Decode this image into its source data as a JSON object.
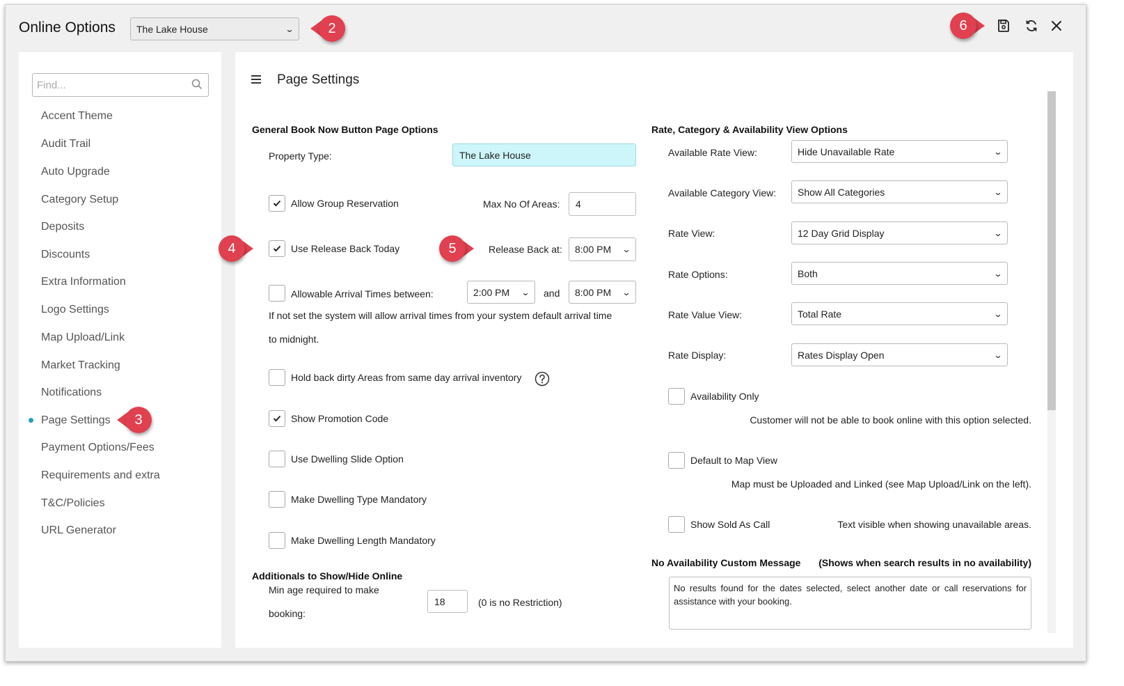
{
  "header": {
    "title": "Online Options",
    "property_select": "The Lake House",
    "callouts": {
      "c2": "2",
      "c3": "3",
      "c4": "4",
      "c5": "5",
      "c6": "6"
    }
  },
  "toolbar_icons": [
    "save-icon",
    "refresh-icon",
    "close-icon"
  ],
  "sidebar": {
    "search_placeholder": "Find...",
    "items": [
      "Accent Theme",
      "Audit Trail",
      "Auto Upgrade",
      "Category Setup",
      "Deposits",
      "Discounts",
      "Extra Information",
      "Logo Settings",
      "Map Upload/Link",
      "Market Tracking",
      "Notifications",
      "Page Settings",
      "Payment Options/Fees",
      "Requirements and extra",
      "T&C/Policies",
      "URL Generator"
    ],
    "active": "Page Settings"
  },
  "main": {
    "title": "Page Settings",
    "general": {
      "heading": "General Book Now Button Page Options",
      "property_type_label": "Property Type:",
      "property_type_value": "The Lake House",
      "allow_group_label": "Allow Group Reservation",
      "allow_group_checked": true,
      "max_areas_label": "Max No Of Areas:",
      "max_areas_value": "4",
      "release_back_label": "Use Release Back Today",
      "release_back_checked": true,
      "release_back_at_label": "Release Back at:",
      "release_back_at_value": "8:00 PM",
      "arrival_label": "Allowable Arrival Times between:",
      "arrival_checked": false,
      "arrival_from": "2:00 PM",
      "arrival_and": "and",
      "arrival_to": "8:00 PM",
      "arrival_note_line1": "If not set the system will allow arrival times from your system default arrival time",
      "arrival_note_line2": "to midnight.",
      "hold_back_label": "Hold back dirty Areas from same day arrival inventory",
      "hold_back_checked": false,
      "promo_label": "Show Promotion Code",
      "promo_checked": true,
      "dwelling_slide_label": "Use Dwelling Slide Option",
      "dwelling_slide_checked": false,
      "dwelling_type_label": "Make Dwelling Type Mandatory",
      "dwelling_type_checked": false,
      "dwelling_length_label": "Make Dwelling Length Mandatory",
      "dwelling_length_checked": false
    },
    "additionals": {
      "heading": "Additionals to Show/Hide Online",
      "min_age_line1": "Min age required to make",
      "min_age_line2": "booking:",
      "min_age_value": "18",
      "min_age_note": "(0 is no Restriction)"
    },
    "rate": {
      "heading": "Rate, Category & Availability View Options",
      "available_rate_view_label": "Available Rate View:",
      "available_rate_view_value": "Hide Unavailable Rate",
      "available_category_view_label": "Available Category View:",
      "available_category_view_value": "Show All Categories",
      "rate_view_label": "Rate View:",
      "rate_view_value": "12 Day Grid Display",
      "rate_options_label": "Rate Options:",
      "rate_options_value": "Both",
      "rate_value_view_label": "Rate Value View:",
      "rate_value_view_value": "Total Rate",
      "rate_display_label": "Rate Display:",
      "rate_display_value": "Rates Display Open",
      "availability_only_label": "Availability Only",
      "availability_only_checked": false,
      "availability_only_note": "Customer will not be able to book online with this option selected.",
      "default_map_label": "Default to Map View",
      "default_map_checked": false,
      "default_map_note": "Map must be Uploaded and Linked (see Map Upload/Link on the left).",
      "sold_as_call_label": "Show Sold As Call",
      "sold_as_call_checked": false,
      "sold_as_call_note": "Text visible when showing unavailable areas.",
      "no_avail_heading": "No Availability Custom Message",
      "no_avail_hint": "(Shows when search results in no availability)",
      "no_avail_message": "No results found for the dates selected, select another date or call reservations for assistance with your booking."
    }
  }
}
